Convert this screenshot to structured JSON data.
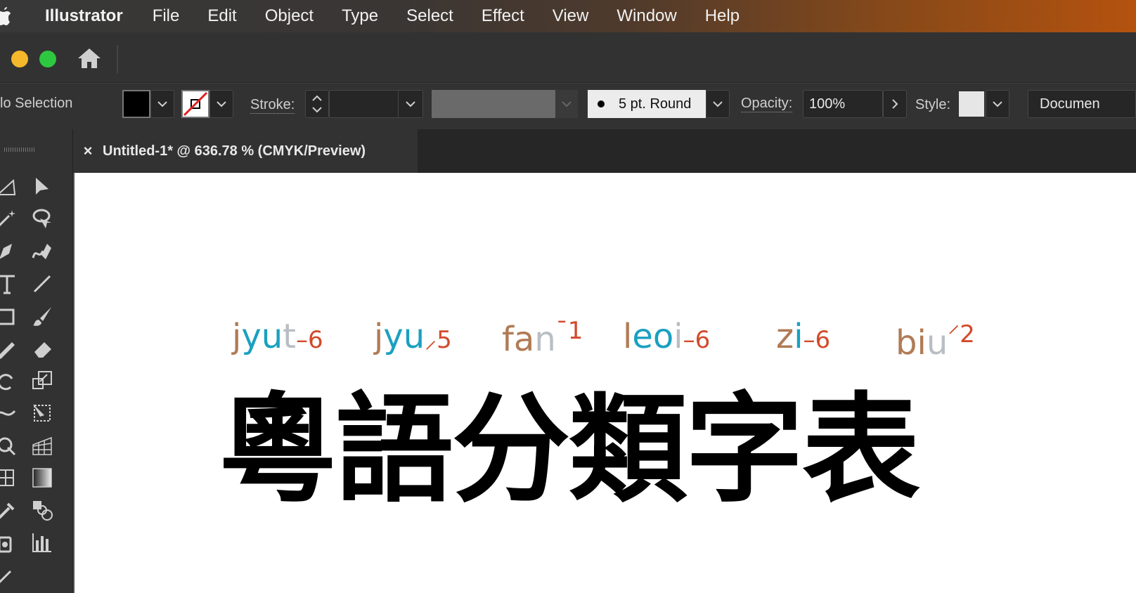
{
  "menubar": {
    "app_name": "Illustrator",
    "items": [
      "File",
      "Edit",
      "Object",
      "Type",
      "Select",
      "Effect",
      "View",
      "Window",
      "Help"
    ]
  },
  "controlbar": {
    "selection_label": "lo Selection",
    "stroke_label": "Stroke:",
    "brush_value": "5 pt. Round",
    "opacity_label": "Opacity:",
    "opacity_value": "100%",
    "style_label": "Style:",
    "document_button": "Documen"
  },
  "tab": {
    "title": "Untitled-1* @ 636.78 % (CMYK/Preview)"
  },
  "canvas": {
    "jyutping": [
      {
        "initial": "j",
        "final": "yu",
        "coda": "t",
        "tone": "6",
        "tone_mark": "–"
      },
      {
        "initial": "j",
        "final": "yu",
        "coda": "",
        "tone": "5",
        "tone_mark": "⸝"
      },
      {
        "initial": "f",
        "final": "a",
        "coda": "n",
        "tone": "1",
        "tone_mark": "¯"
      },
      {
        "initial": "l",
        "final": "eo",
        "coda": "i",
        "tone": "6",
        "tone_mark": "–"
      },
      {
        "initial": "z",
        "final": "i",
        "coda": "",
        "tone": "6",
        "tone_mark": "–"
      },
      {
        "initial": "b",
        "final": "i",
        "coda": "u",
        "tone": "2",
        "tone_mark": "⸍"
      }
    ],
    "title_chars": "粵語分類字表"
  },
  "colors": {
    "initial": "#b07b55",
    "final": "#1aa0c0",
    "coda": "#b8bec4",
    "tone": "#d24a2a"
  }
}
